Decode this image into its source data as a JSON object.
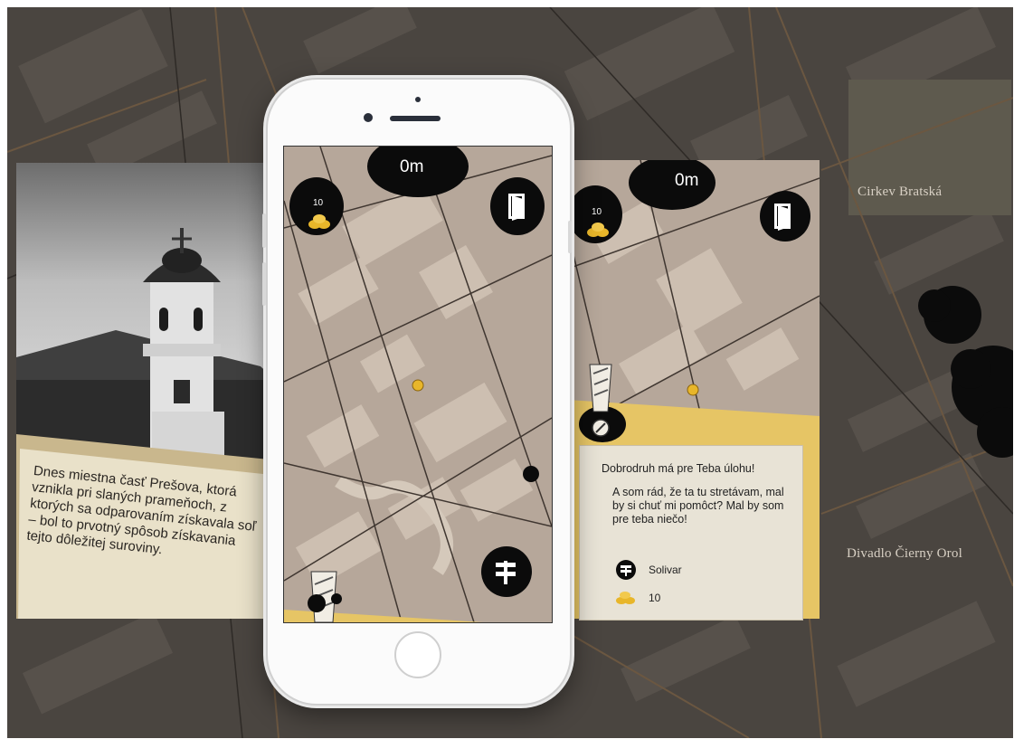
{
  "map": {
    "labels": [
      "Cirkev Bratská",
      "Divadlo Čierny Orol"
    ]
  },
  "left_card": {
    "text": "Dnes miestna časť Prešova, ktorá vznikla pri slaných prameňoch, z ktorých sa odparovaním získavala soľ – bol to prvotný spôsob získavania tejto dôležitej suroviny."
  },
  "phone_screen": {
    "distance": "0m",
    "coins": "10",
    "icons": [
      "coins-icon",
      "exit-door-icon",
      "signpost-icon",
      "exclamation-icon"
    ]
  },
  "right_card": {
    "distance": "0m",
    "coins": "10",
    "dialog": {
      "title": "Dobrodruh má pre Teba úlohu!",
      "body": "A som rád, že ta tu stretávam, mal by si chuť mi pomôct? Mal by som pre teba niečo!",
      "location_label": "Solivar",
      "reward_value": "10"
    }
  },
  "colors": {
    "map_dark": "#4a4540",
    "screen_map": "#b6a79a",
    "paper_yellow": "#e6c565",
    "coin_gold": "#e8b62a",
    "ink": "#0a0a0a"
  }
}
